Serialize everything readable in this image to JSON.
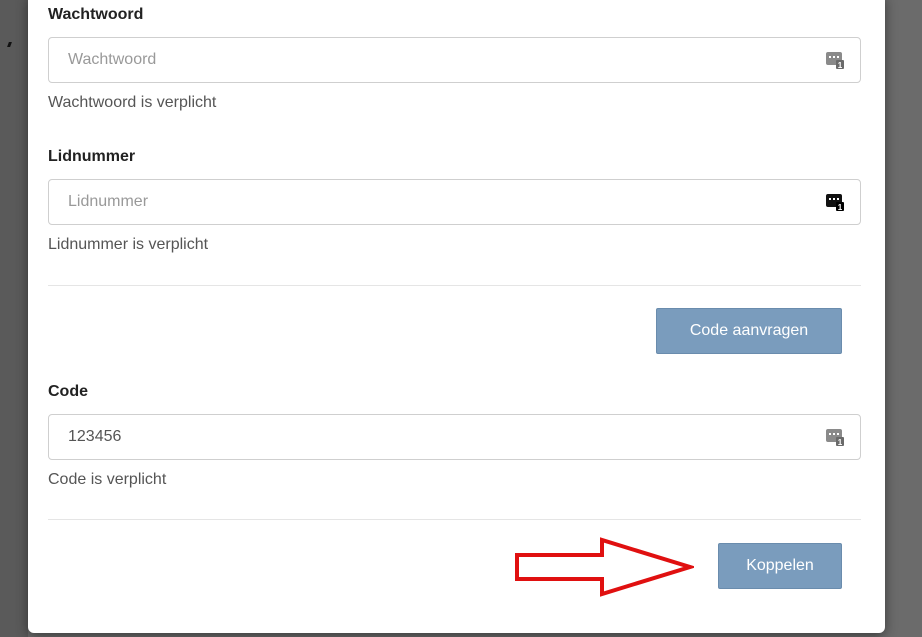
{
  "form": {
    "password": {
      "label": "Wachtwoord",
      "placeholder": "Wachtwoord",
      "value": "",
      "help": "Wachtwoord is verplicht"
    },
    "member_number": {
      "label": "Lidnummer",
      "placeholder": "Lidnummer",
      "value": "",
      "help": "Lidnummer is verplicht"
    },
    "request_code_button": "Code aanvragen",
    "code": {
      "label": "Code",
      "placeholder": "",
      "value": "123456",
      "help": "Code is verplicht"
    },
    "link_button": "Koppelen"
  },
  "icons": {
    "field_icon": "password-manager-key-icon",
    "annotation": "red-outline-arrow"
  },
  "colors": {
    "button_bg": "#7a9cbd",
    "annotation_arrow": "#e01010"
  }
}
